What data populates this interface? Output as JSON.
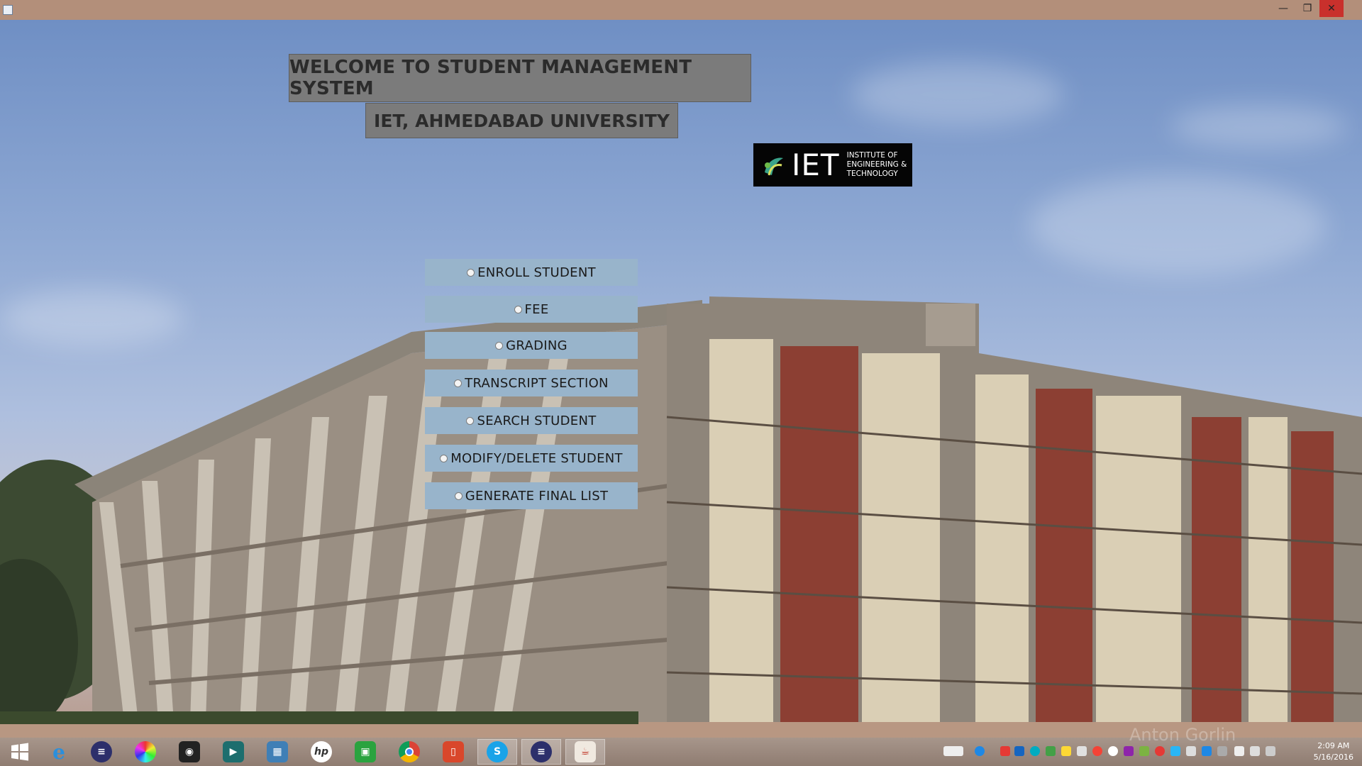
{
  "window": {
    "minimize_glyph": "—",
    "maximize_glyph": "❐",
    "close_glyph": "✕"
  },
  "heading": {
    "title": "WELCOME TO STUDENT MANAGEMENT SYSTEM",
    "subtitle": "IET, AHMEDABAD UNIVERSITY"
  },
  "logo": {
    "big_text": "IET",
    "line1": "INSTITUTE OF",
    "line2": "ENGINEERING &",
    "line3": "TECHNOLOGY"
  },
  "menu": {
    "options": [
      {
        "label": "ENROLL STUDENT"
      },
      {
        "label": "FEE"
      },
      {
        "label": "GRADING"
      },
      {
        "label": "TRANSCRIPT SECTION"
      },
      {
        "label": "SEARCH STUDENT"
      },
      {
        "label": "MODIFY/DELETE STUDENT"
      },
      {
        "label": "GENERATE FINAL LIST"
      }
    ]
  },
  "taskbar": {
    "apps": [
      {
        "icon": "windows-start-icon"
      },
      {
        "icon": "internet-explorer-icon"
      },
      {
        "icon": "eclipse-icon"
      },
      {
        "icon": "color-picker-icon"
      },
      {
        "icon": "camera-app-icon"
      },
      {
        "icon": "video-app-icon"
      },
      {
        "icon": "network-app-icon"
      },
      {
        "icon": "hp-icon"
      },
      {
        "icon": "store-icon"
      },
      {
        "icon": "chrome-icon"
      },
      {
        "icon": "office-icon"
      },
      {
        "icon": "skype-icon"
      },
      {
        "icon": "eclipse-icon"
      },
      {
        "icon": "java-icon"
      }
    ],
    "clock_time": "2:09 AM",
    "clock_date": "5/16/2016"
  },
  "watermark": "Anton Gorlin",
  "colors": {
    "heading_bg": "#7b7b7b",
    "menu_bg": "#98b4cb",
    "titlebar": "#b38f7a",
    "close": "#c9302c"
  }
}
